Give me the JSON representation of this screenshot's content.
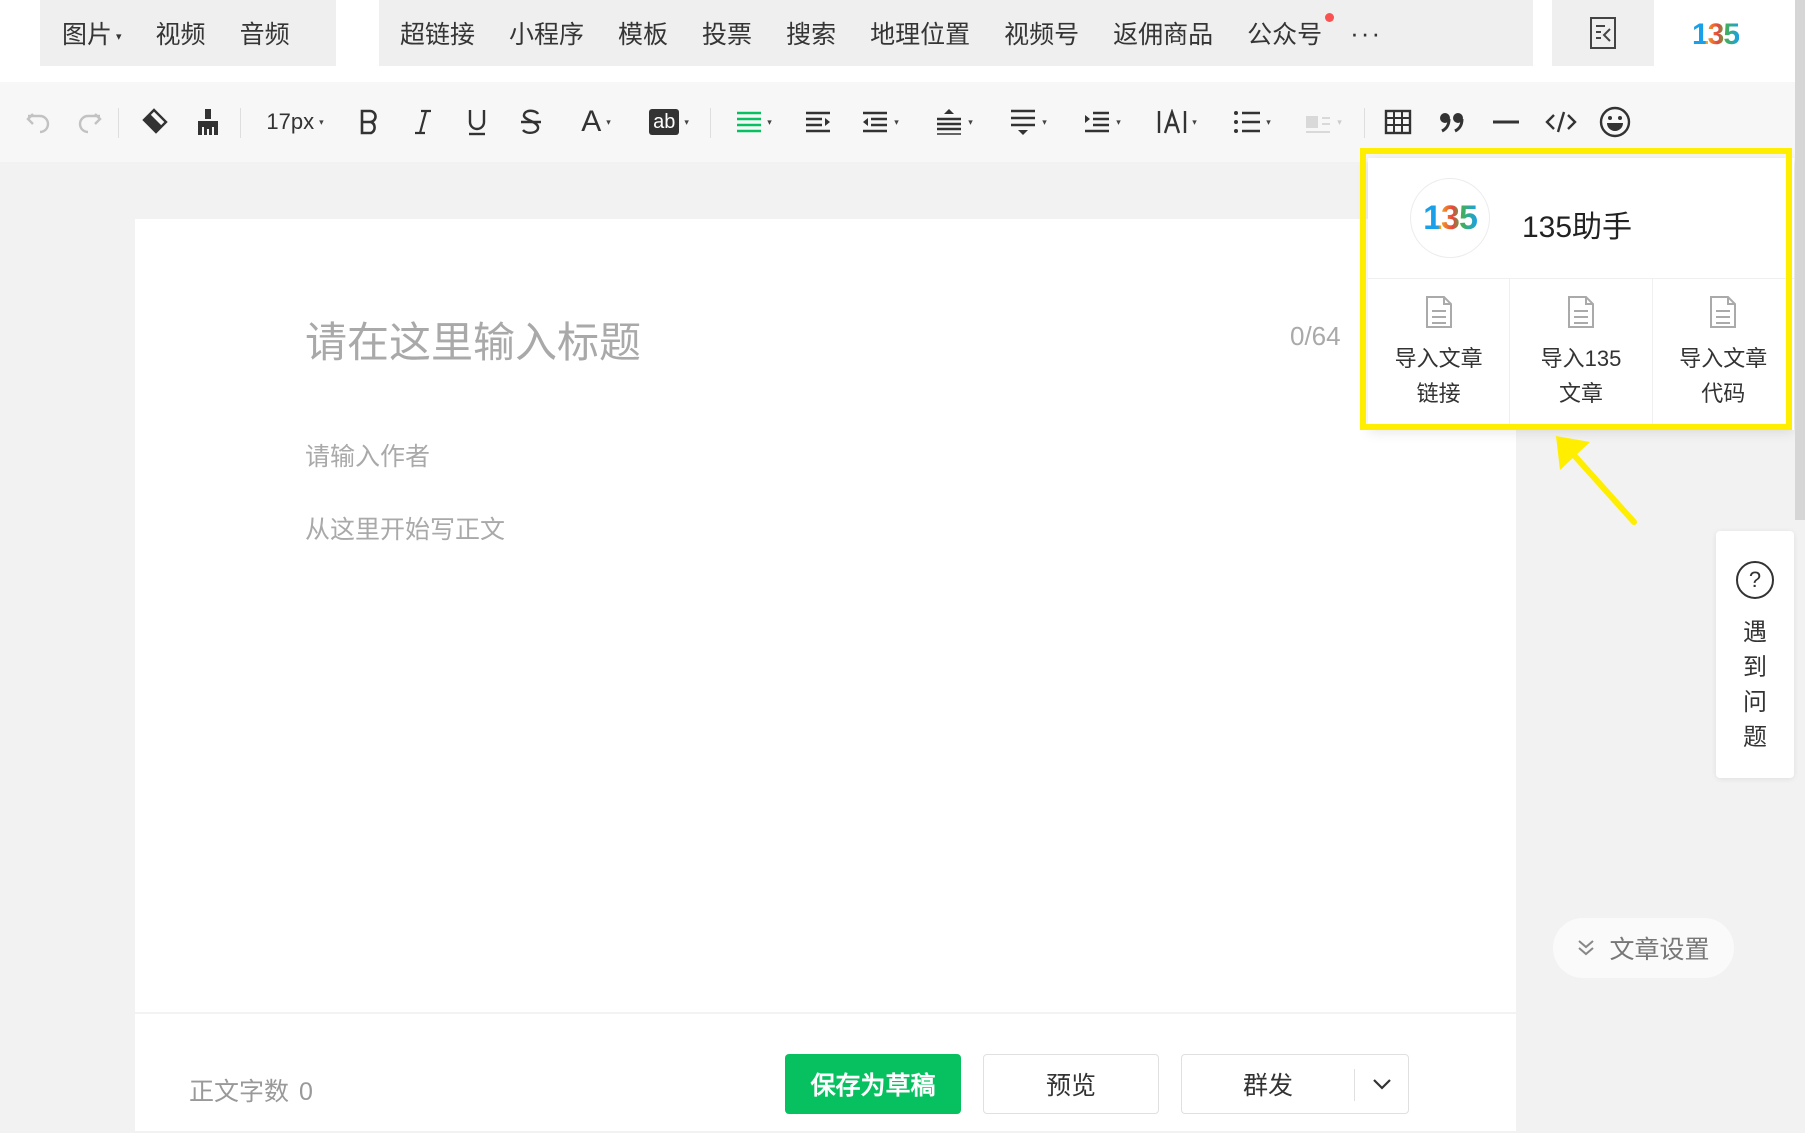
{
  "insert_bar": {
    "group1": [
      {
        "label": "图片",
        "dropdown": true
      },
      {
        "label": "视频",
        "dropdown": false
      },
      {
        "label": "音频",
        "dropdown": false
      }
    ],
    "group2": [
      {
        "label": "超链接"
      },
      {
        "label": "小程序"
      },
      {
        "label": "模板"
      },
      {
        "label": "投票"
      },
      {
        "label": "搜索"
      },
      {
        "label": "地理位置"
      },
      {
        "label": "视频号"
      },
      {
        "label": "返佣商品"
      },
      {
        "label": "公众号",
        "badge_dot": true
      }
    ],
    "more_icon": "more-dots-icon",
    "import_icon": "document-import-icon",
    "logo_text": "135"
  },
  "format_toolbar": {
    "font_size": "17px",
    "text_color_letter": "A",
    "highlight_label": "ab",
    "icons": [
      "undo-icon",
      "redo-icon",
      "eraser-icon",
      "format-painter-icon",
      "font-size-dropdown",
      "bold-icon",
      "italic-icon",
      "underline-icon",
      "strikethrough-icon",
      "font-color-icon",
      "background-color-icon",
      "align-icon",
      "indent-icon",
      "first-line-indent-icon",
      "paragraph-spacing-icon",
      "line-spacing-icon",
      "letter-spacing-icon",
      "text-width-icon",
      "list-icon",
      "float-image-icon",
      "table-icon",
      "quote-icon",
      "divider-icon",
      "code-icon",
      "emoji-icon"
    ]
  },
  "editor": {
    "title_placeholder": "请在这里输入标题",
    "title_counter": "0/64",
    "author_placeholder": "请输入作者",
    "body_placeholder": "从这里开始写正文",
    "word_count_label": "正文字数",
    "word_count_value": "0",
    "save_draft_label": "保存为草稿",
    "preview_label": "预览",
    "publish_label": "群发"
  },
  "popup": {
    "logo_text": "135",
    "title": "135助手",
    "actions": [
      {
        "line1": "导入文章",
        "line2": "链接",
        "icon": "document-icon"
      },
      {
        "line1": "导入135",
        "line2": "文章",
        "icon": "document-icon"
      },
      {
        "line1": "导入文章",
        "line2": "代码",
        "icon": "document-icon"
      }
    ]
  },
  "side": {
    "help_text": "遇到问题",
    "help_icon": "question-circle-icon",
    "settings_label": "文章设置"
  },
  "colors": {
    "highlight": "#ffee00",
    "primary_green": "#07c160",
    "badge_red": "#fa5151"
  }
}
